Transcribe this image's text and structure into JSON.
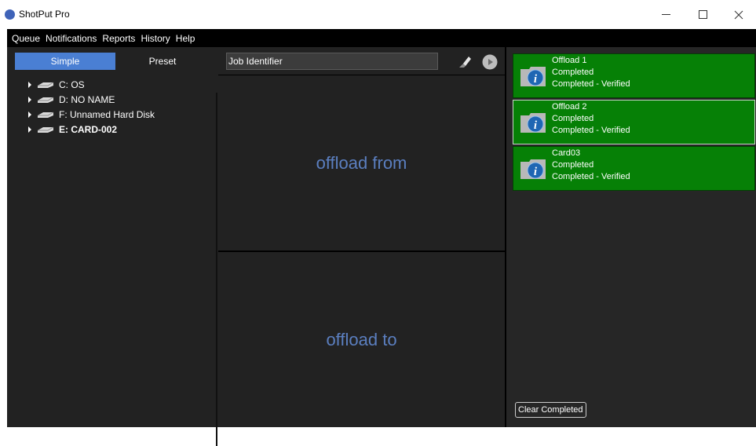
{
  "window": {
    "title": "ShotPut Pro",
    "controls": {
      "minimize": "minimize",
      "maximize": "maximize",
      "close": "close"
    }
  },
  "menu": [
    "Queue",
    "Notifications",
    "Reports",
    "History",
    "Help"
  ],
  "left_panel": {
    "tabs": {
      "simple": "Simple",
      "preset": "Preset"
    },
    "drives": [
      {
        "label": "C: OS",
        "bold": false
      },
      {
        "label": "D: NO NAME",
        "bold": false
      },
      {
        "label": "F: Unnamed Hard Disk",
        "bold": false
      },
      {
        "label": "E: CARD-002",
        "bold": true
      }
    ]
  },
  "middle_panel": {
    "job_identifier_placeholder": "Job Identifier",
    "offload_from": "offload from",
    "offload_to": "offload to"
  },
  "queue": {
    "items": [
      {
        "name": "Offload 1",
        "status": "Completed",
        "detail": "Completed - Verified"
      },
      {
        "name": "Offload 2",
        "status": "Completed",
        "detail": "Completed - Verified"
      },
      {
        "name": "Card03",
        "status": "Completed",
        "detail": "Completed - Verified"
      }
    ],
    "clear_label": "Clear Completed"
  },
  "colors": {
    "accent": "#4a7fd3",
    "queue_completed": "#068006",
    "drop_text": "#5b7fc0",
    "panel_bg": "#222222"
  },
  "icons": {
    "app": "shotput-logo-icon",
    "drive": "hard-drive-icon",
    "eraser": "eraser-icon",
    "play": "play-icon",
    "info": "info-icon"
  }
}
